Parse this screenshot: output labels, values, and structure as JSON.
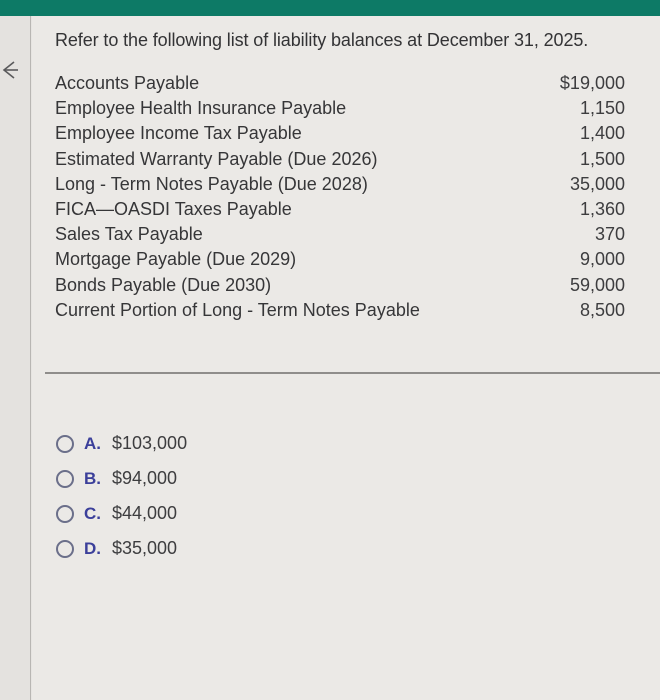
{
  "header": {
    "accent_color": "#0d7a66"
  },
  "navigation": {
    "back_icon": "back-arrow-icon"
  },
  "question": {
    "prompt": "Refer to the following list of liability balances at December 31, 2025."
  },
  "liabilities": [
    {
      "name": "Accounts Payable",
      "amount": "$19,000"
    },
    {
      "name": "Employee Health Insurance Payable",
      "amount": "1,150"
    },
    {
      "name": "Employee Income Tax Payable",
      "amount": "1,400"
    },
    {
      "name": "Estimated Warranty Payable (Due 2026)",
      "amount": "1,500"
    },
    {
      "name": "Long - Term Notes Payable (Due 2028)",
      "amount": "35,000"
    },
    {
      "name": "FICA—OASDI Taxes Payable",
      "amount": "1,360"
    },
    {
      "name": "Sales Tax Payable",
      "amount": "370"
    },
    {
      "name": "Mortgage Payable (Due 2029)",
      "amount": "9,000"
    },
    {
      "name": "Bonds Payable (Due 2030)",
      "amount": "59,000"
    },
    {
      "name": "Current Portion of Long - Term Notes Payable",
      "amount": "8,500"
    }
  ],
  "options": [
    {
      "letter": "A.",
      "value": "$103,000",
      "selected": false
    },
    {
      "letter": "B.",
      "value": "$94,000",
      "selected": false
    },
    {
      "letter": "C.",
      "value": "$44,000",
      "selected": false
    },
    {
      "letter": "D.",
      "value": "$35,000",
      "selected": false
    }
  ]
}
